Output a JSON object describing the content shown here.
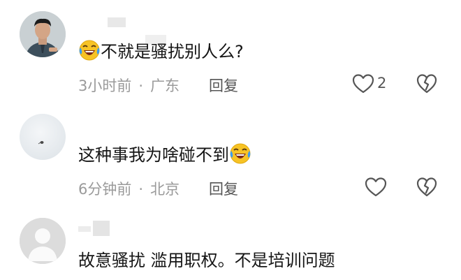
{
  "comments": [
    {
      "text": "不就是骚扰别人么?",
      "time": "3小时前",
      "location": "广东",
      "reply_label": "回复",
      "like_count": "2",
      "emoji": "rofl-emoji",
      "avatar": "user-photo-avatar"
    },
    {
      "text": "这种事我为啥碰不到",
      "time": "6分钟前",
      "location": "北京",
      "reply_label": "回复",
      "like_count": "",
      "emoji": "rofl-emoji",
      "avatar": "snow-scene-avatar"
    },
    {
      "text": "故意骚扰 滥用职权。不是培训问题",
      "avatar": "default-user-avatar"
    }
  ],
  "separator": "·",
  "colors": {
    "meta_gray": "#9a9a9a",
    "icon_gray": "#555555",
    "emoji_yellow": "#f7c325",
    "tear_blue": "#3b9cf1"
  }
}
